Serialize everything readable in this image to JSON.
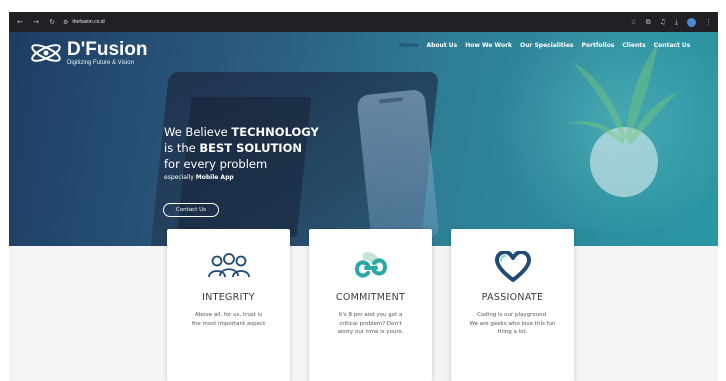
{
  "browser": {
    "url": "thefusion.co.id"
  },
  "brand": {
    "name": "D'Fusion",
    "tagline": "Digitizing Future & Vision"
  },
  "nav": {
    "items": [
      "Home",
      "About Us",
      "How We Work",
      "Our Specialities",
      "Portfolios",
      "Clients",
      "Contact Us"
    ]
  },
  "hero": {
    "line1_prefix": "We Believe ",
    "line1_bold": "TECHNOLOGY",
    "line2_prefix": "is the ",
    "line2_bold": "BEST SOLUTION",
    "line3": "for every problem",
    "line4_prefix": "especially ",
    "line4_bold": "Mobile App",
    "cta_label": "Contact Us"
  },
  "cards": [
    {
      "icon": "team-icon",
      "title": "INTEGRITY",
      "lines": [
        "Above all, for us, trust is",
        "the most important aspect"
      ]
    },
    {
      "icon": "link-icon",
      "title": "COMMITMENT",
      "lines": [
        "It's 8 pm and you got a",
        "critical problem? Don't",
        "worry our time is yours."
      ]
    },
    {
      "icon": "heart-icon",
      "title": "PASSIONATE",
      "lines": [
        "Coding is our playground.",
        "We are geeks who love this fun",
        "thing a lot."
      ]
    }
  ],
  "colors": {
    "hero_dark": "#1f3d63",
    "hero_light": "#2a97a3",
    "accent_teal": "#2aa8a6",
    "accent_navy": "#1f4b77"
  }
}
